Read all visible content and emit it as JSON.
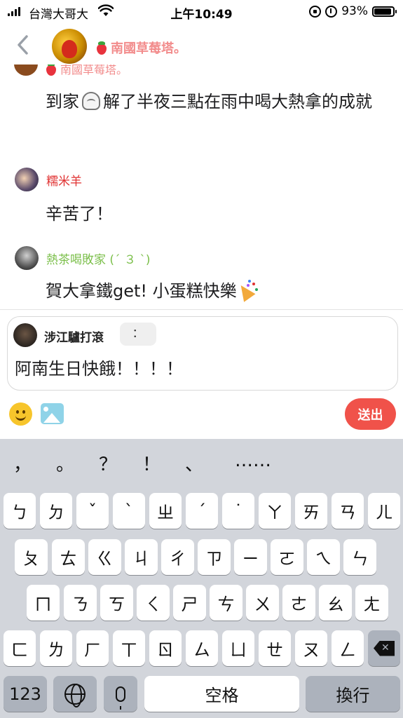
{
  "status_bar": {
    "carrier": "台灣大哥大",
    "time": "上午10:49",
    "battery": "93%",
    "battery_level": 0.93
  },
  "header": {
    "title": "南國草莓塔。"
  },
  "messages": {
    "partial_name": "南國草莓塔。",
    "msg1_text": "到家",
    "msg1_text_b": "解了半夜三點在雨中喝大熱拿的成就",
    "user2_name": "糯米羊",
    "msg2_text": "辛苦了！",
    "user3_name": "熱茶喝敗家 (´ ３ `)",
    "msg3_text": "賀大拿鐵get! 小蛋糕快樂"
  },
  "composer": {
    "reply_name": "涉江驢打滾",
    "reply_chip": "：",
    "text": "阿南生日快餓！！！！"
  },
  "actions": {
    "send_label": "送出"
  },
  "keyboard": {
    "punctuation": [
      "，",
      "。",
      "？",
      "！",
      "、",
      "……"
    ],
    "row1": [
      "ㄅ",
      "ㄉ",
      "ˇ",
      "ˋ",
      "ㄓ",
      "ˊ",
      "˙",
      "ㄚ",
      "ㄞ",
      "ㄢ",
      "ㄦ"
    ],
    "row2": [
      "ㄆ",
      "ㄊ",
      "ㄍ",
      "ㄐ",
      "ㄔ",
      "ㄗ",
      "ㄧ",
      "ㄛ",
      "ㄟ",
      "ㄣ"
    ],
    "row3": [
      "ㄇ",
      "ㄋ",
      "ㄎ",
      "ㄑ",
      "ㄕ",
      "ㄘ",
      "ㄨ",
      "ㄜ",
      "ㄠ",
      "ㄤ"
    ],
    "row4": [
      "ㄈ",
      "ㄌ",
      "ㄏ",
      "ㄒ",
      "ㄖ",
      "ㄙ",
      "ㄩ",
      "ㄝ",
      "ㄡ",
      "ㄥ"
    ],
    "num_key": "123",
    "space_key": "空格",
    "return_key": "換行"
  }
}
